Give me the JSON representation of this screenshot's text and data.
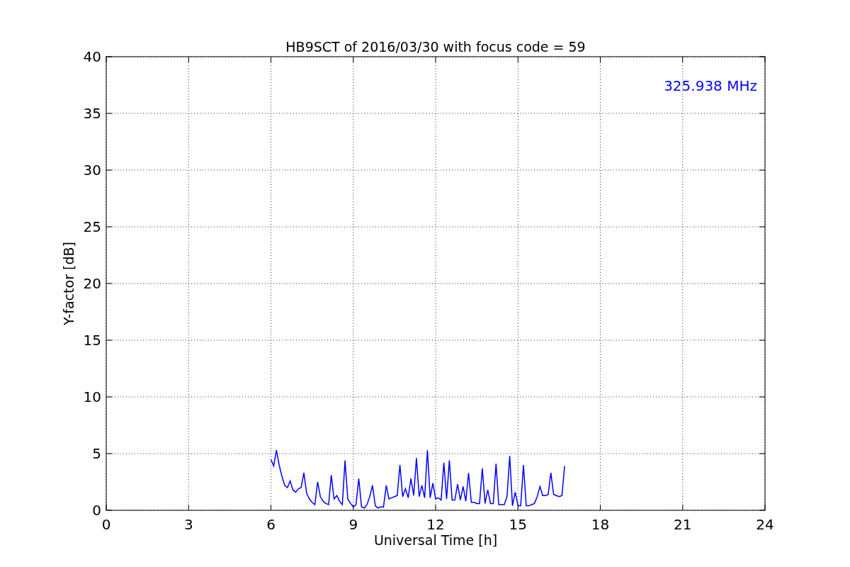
{
  "chart_data": {
    "type": "line",
    "title": "HB9SCT of 2016/03/30 with focus code = 59",
    "xlabel": "Universal Time [h]",
    "ylabel": "Y-factor [dB]",
    "x": [
      6.0,
      6.1,
      6.2,
      6.3,
      6.4,
      6.5,
      6.6,
      6.7,
      6.8,
      6.9,
      7.0,
      7.1,
      7.2,
      7.3,
      7.4,
      7.5,
      7.6,
      7.7,
      7.8,
      7.9,
      8.0,
      8.1,
      8.2,
      8.3,
      8.4,
      8.5,
      8.6,
      8.7,
      8.8,
      8.9,
      9.0,
      9.1,
      9.2,
      9.3,
      9.4,
      9.5,
      9.6,
      9.7,
      9.8,
      9.9,
      10.0,
      10.1,
      10.2,
      10.3,
      10.4,
      10.5,
      10.6,
      10.7,
      10.8,
      10.9,
      11.0,
      11.1,
      11.2,
      11.3,
      11.4,
      11.5,
      11.6,
      11.7,
      11.8,
      11.9,
      12.0,
      12.1,
      12.2,
      12.3,
      12.4,
      12.5,
      12.6,
      12.7,
      12.8,
      12.9,
      13.0,
      13.1,
      13.2,
      13.3,
      13.4,
      13.5,
      13.6,
      13.7,
      13.8,
      13.9,
      14.0,
      14.1,
      14.2,
      14.3,
      14.4,
      14.5,
      14.6,
      14.7,
      14.8,
      14.9,
      15.0,
      15.1,
      15.2,
      15.3,
      15.4,
      15.5,
      15.6,
      15.7,
      15.8,
      15.9,
      16.0,
      16.1,
      16.2,
      16.3,
      16.4,
      16.5,
      16.6,
      16.7
    ],
    "series": [
      {
        "name": "325.938 MHz",
        "color": "#0000ff",
        "values": [
          4.5,
          3.9,
          5.3,
          4.0,
          3.0,
          2.2,
          2.0,
          2.6,
          1.8,
          1.6,
          1.9,
          2.0,
          3.3,
          1.5,
          1.0,
          0.7,
          0.5,
          2.5,
          1.2,
          0.8,
          0.6,
          0.5,
          3.1,
          1.0,
          1.3,
          0.8,
          0.5,
          4.4,
          1.0,
          0.6,
          0.3,
          0.5,
          2.8,
          0.3,
          0.2,
          0.5,
          1.2,
          2.2,
          0.4,
          0.2,
          0.3,
          0.3,
          2.2,
          1.0,
          1.1,
          1.2,
          1.3,
          4.0,
          1.2,
          1.9,
          1.1,
          2.8,
          1.3,
          4.6,
          1.2,
          2.2,
          1.1,
          5.3,
          1.1,
          2.4,
          1.0,
          1.1,
          0.9,
          4.2,
          1.0,
          4.4,
          0.9,
          0.9,
          2.3,
          0.9,
          2.1,
          0.8,
          3.3,
          0.7,
          0.7,
          0.6,
          0.6,
          3.7,
          0.6,
          1.8,
          0.6,
          0.6,
          4.1,
          0.5,
          0.5,
          0.5,
          1.2,
          4.8,
          0.4,
          1.6,
          0.4,
          0.4,
          4.0,
          0.4,
          0.4,
          0.5,
          0.6,
          1.2,
          2.1,
          1.3,
          1.3,
          1.4,
          3.3,
          1.4,
          1.3,
          1.2,
          1.3,
          3.9
        ]
      }
    ],
    "xlim": [
      0,
      24
    ],
    "ylim": [
      0,
      40
    ],
    "xticks": [
      0,
      3,
      6,
      9,
      12,
      15,
      18,
      21,
      24
    ],
    "yticks": [
      0,
      5,
      10,
      15,
      20,
      25,
      30,
      35,
      40
    ],
    "grid": true
  }
}
